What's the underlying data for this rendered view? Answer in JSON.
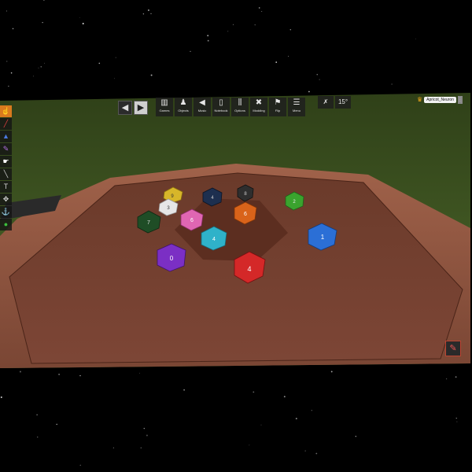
{
  "toolbar": {
    "back_icon": "left-arrow-icon",
    "forward_icon": "right-arrow-icon",
    "buttons": [
      {
        "label": "Games",
        "icon": "boxes-icon",
        "glyph": "▥"
      },
      {
        "label": "Objects",
        "icon": "pawn-icon",
        "glyph": "♟"
      },
      {
        "label": "Music",
        "icon": "speaker-icon",
        "glyph": "◀"
      },
      {
        "label": "Notebook",
        "icon": "notebook-icon",
        "glyph": "▯"
      },
      {
        "label": "Options",
        "icon": "sliders-icon",
        "glyph": "⫼"
      },
      {
        "label": "Modding",
        "icon": "tools-icon",
        "glyph": "✖"
      },
      {
        "label": "Flip",
        "icon": "flip-icon",
        "glyph": "⚑"
      },
      {
        "label": "Menu",
        "icon": "hamburger-icon",
        "glyph": "☰"
      }
    ]
  },
  "view": {
    "camera_icon": "gravity-icon",
    "rotation": "15°"
  },
  "player": {
    "name": "Apricot_Neuron",
    "crown_icon": "crown-icon"
  },
  "left_tools": [
    {
      "icon": "grab-hand-icon",
      "glyph": "☝",
      "color": "#ffffff"
    },
    {
      "icon": "line-tool-icon",
      "glyph": "╱",
      "color": "#e04040"
    },
    {
      "icon": "triangle-icon",
      "glyph": "▲",
      "color": "#4a7ae0"
    },
    {
      "icon": "pen-icon",
      "glyph": "✎",
      "color": "#b070e0"
    },
    {
      "icon": "flick-icon",
      "glyph": "☛",
      "color": "#ffffff"
    },
    {
      "icon": "ruler-icon",
      "glyph": "╲",
      "color": "#d0d0d0"
    },
    {
      "icon": "text-icon",
      "glyph": "T",
      "color": "#d0d0d0"
    },
    {
      "icon": "gizmo-icon",
      "glyph": "✥",
      "color": "#d0d0d0"
    },
    {
      "icon": "joint-icon",
      "glyph": "⚓",
      "color": "#e04040"
    },
    {
      "icon": "color-dot-icon",
      "glyph": "●",
      "color": "#3cbf3c"
    }
  ],
  "dice": [
    {
      "color": "#d7b62a",
      "label": "9"
    },
    {
      "color": "#e6e6e6",
      "label": "3"
    },
    {
      "color": "#1d2f4f",
      "label": "4"
    },
    {
      "color": "#2e2e2e",
      "label": "8"
    },
    {
      "color": "#3aa32e",
      "label": "2"
    },
    {
      "color": "#1f4d26",
      "label": "7"
    },
    {
      "color": "#e066b3",
      "label": "6"
    },
    {
      "color": "#d9631a",
      "label": "6"
    },
    {
      "color": "#2fb2c9",
      "label": "4"
    },
    {
      "color": "#2b6fd6",
      "label": "1"
    },
    {
      "color": "#7b2fc4",
      "label": "0"
    },
    {
      "color": "#d42828",
      "label": "4"
    }
  ],
  "draw_icon": "pencil-icon"
}
